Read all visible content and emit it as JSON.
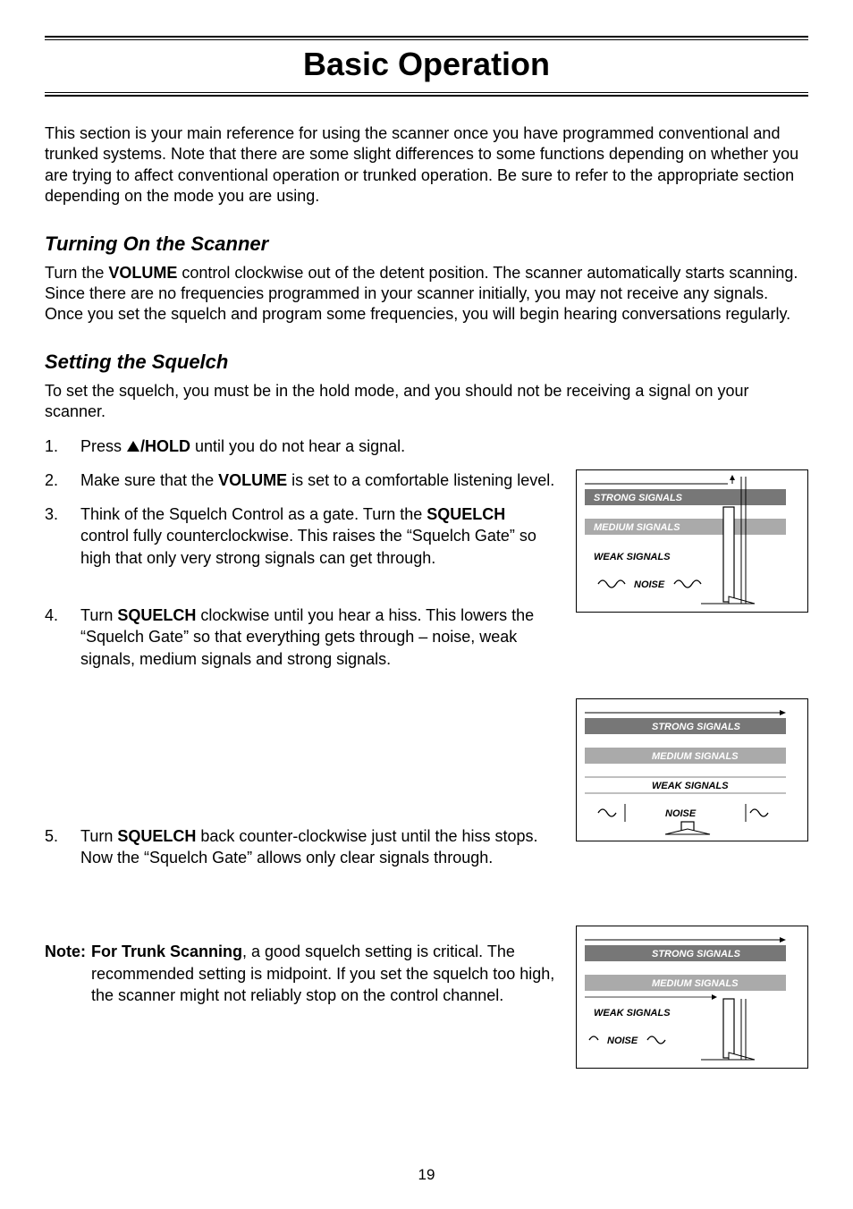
{
  "page": {
    "title": "Basic Operation",
    "intro": "This section is your main reference for using the scanner once you have programmed conventional and trunked systems. Note that there are some slight differences to some functions depending on whether you are trying to affect conventional operation or trunked operation. Be sure to refer to the appropriate section depending on the mode you are using.",
    "page_number": "19"
  },
  "sections": {
    "turning_on": {
      "heading": "Turning On the Scanner",
      "body_pre": "Turn the ",
      "volume": "VOLUME",
      "body_post": " control clockwise out of the detent position. The scanner automatically starts scanning. Since there are no frequencies programmed in your scanner initially, you may not receive any signals. Once you set the squelch and program some frequencies, you will begin hearing conversations regularly."
    },
    "squelch": {
      "heading": "Setting the Squelch",
      "intro": "To set the squelch, you must be in the hold mode, and you should not be receiving a signal on your scanner.",
      "step1_pre": "Press ",
      "step1_hold": "/HOLD",
      "step1_post": " until you do not hear a signal.",
      "step2_pre": "Make sure that the ",
      "step2_vol": "VOLUME",
      "step2_post": " is set to a comfortable listening level.",
      "step3_pre": "Think of the Squelch Control as a gate. Turn the ",
      "step3_sq": "SQUELCH",
      "step3_post": " control fully counterclockwise. This raises the “Squelch Gate” so high that only very strong signals can get through.",
      "step4_pre": "Turn ",
      "step4_sq": "SQUELCH",
      "step4_post": " clockwise until you hear a hiss. This lowers the “Squelch Gate” so that everything gets through – noise, weak signals, medium signals and strong signals.",
      "step5_pre": "Turn ",
      "step5_sq": "SQUELCH",
      "step5_post": " back counter-clockwise just until the hiss stops. Now the “Squelch Gate” allows only clear signals through.",
      "note_label": "Note:",
      "note_bold": "For Trunk Scanning",
      "note_body": ", a good squelch setting is critical. The recommended setting is midpoint. If you set the squelch too high, the scanner might not reliably stop on the control channel."
    }
  },
  "diagram_labels": {
    "strong": "STRONG SIGNALS",
    "medium": "MEDIUM SIGNALS",
    "weak": "WEAK SIGNALS",
    "noise": "NOISE"
  }
}
